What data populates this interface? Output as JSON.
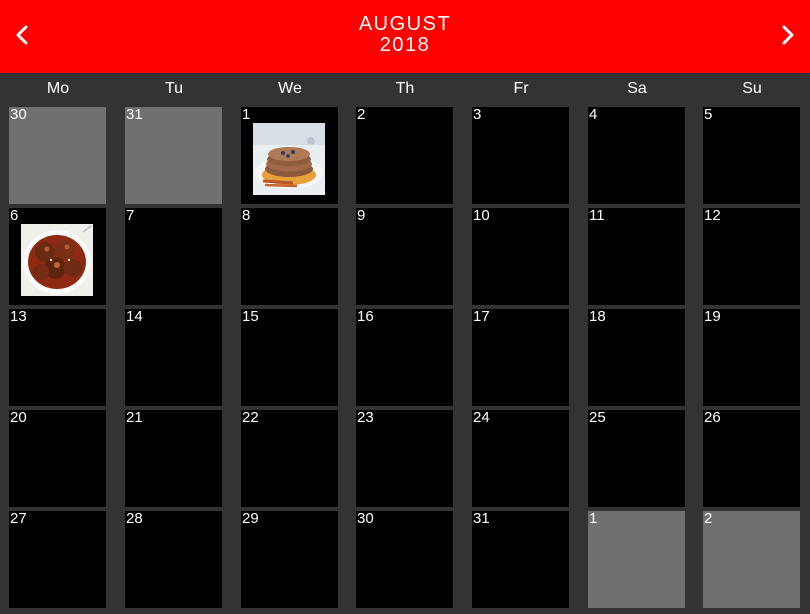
{
  "header": {
    "month": "AUGUST",
    "year": "2018",
    "prev_icon": "chevron-left-icon",
    "next_icon": "chevron-right-icon"
  },
  "colors": {
    "header_bg": "#ff0000",
    "page_bg": "#333333",
    "day_bg": "#000000",
    "other_month_bg": "#707070",
    "text": "#ffffff"
  },
  "weekdays": [
    "Mo",
    "Tu",
    "We",
    "Th",
    "Fr",
    "Sa",
    "Su"
  ],
  "weeks": [
    [
      {
        "day": "30",
        "other": true
      },
      {
        "day": "31",
        "other": true
      },
      {
        "day": "1",
        "photo": "pancakes-photo"
      },
      {
        "day": "2"
      },
      {
        "day": "3"
      },
      {
        "day": "4"
      },
      {
        "day": "5"
      }
    ],
    [
      {
        "day": "6",
        "photo": "meatballs-photo"
      },
      {
        "day": "7"
      },
      {
        "day": "8"
      },
      {
        "day": "9"
      },
      {
        "day": "10"
      },
      {
        "day": "11"
      },
      {
        "day": "12"
      }
    ],
    [
      {
        "day": "13"
      },
      {
        "day": "14"
      },
      {
        "day": "15"
      },
      {
        "day": "16"
      },
      {
        "day": "17"
      },
      {
        "day": "18"
      },
      {
        "day": "19"
      }
    ],
    [
      {
        "day": "20"
      },
      {
        "day": "21"
      },
      {
        "day": "22"
      },
      {
        "day": "23"
      },
      {
        "day": "24"
      },
      {
        "day": "25"
      },
      {
        "day": "26"
      }
    ],
    [
      {
        "day": "27"
      },
      {
        "day": "28"
      },
      {
        "day": "29"
      },
      {
        "day": "30"
      },
      {
        "day": "31"
      },
      {
        "day": "1",
        "other": true
      },
      {
        "day": "2",
        "other": true
      }
    ]
  ]
}
